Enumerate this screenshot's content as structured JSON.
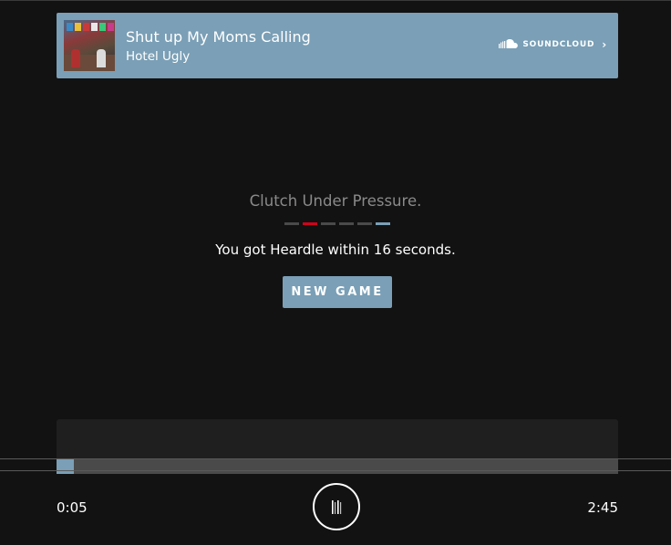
{
  "soundcloud": {
    "track_title": "Shut up My Moms Calling",
    "artist": "Hotel Ugly",
    "brand_label": "SOUNDCLOUD",
    "chevron": "›",
    "artwork_icon": "album-artwork"
  },
  "result": {
    "heading": "Clutch Under Pressure.",
    "message": "You got Heardle within 16 seconds.",
    "new_game_label": "NEW GAME",
    "guesses": [
      "skipped",
      "wrong",
      "skipped",
      "skipped",
      "skipped",
      "correct"
    ]
  },
  "player": {
    "elapsed": "0:05",
    "total": "2:45",
    "progress_fraction": 0.031,
    "play_state_icon": "pause-icon"
  },
  "colors": {
    "accent": "#7a9fb6",
    "wrong": "#d0021b",
    "background": "#121212"
  }
}
